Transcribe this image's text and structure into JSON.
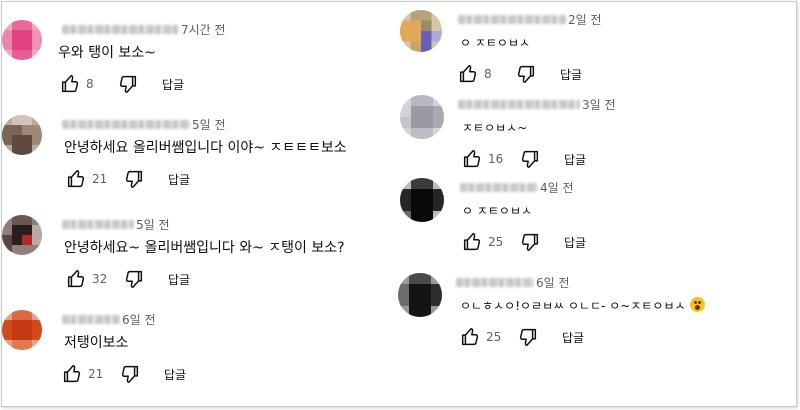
{
  "comments": [
    {
      "time": "7시간 전",
      "text": "우와 탱이 보소~",
      "likes": "8",
      "reply": "답글",
      "avatar": "pink-pixel-avatar"
    },
    {
      "time": "5일 전",
      "text": "안녕하세요 올리버쌤입니다 이야~ ㅈㅌㅌㅌ보소",
      "likes": "21",
      "reply": "답글",
      "avatar": "brown-pixel-avatar"
    },
    {
      "time": "5일 전",
      "text": "안녕하세요~ 올리버쌤입니다 와~ ㅈ탱이 보소?",
      "likes": "32",
      "reply": "답글",
      "avatar": "dark-pixel-avatar"
    },
    {
      "time": "6일 전",
      "text": "저탱이보소",
      "likes": "21",
      "reply": "답글",
      "avatar": "orange-pixel-avatar"
    },
    {
      "time": "2일 전",
      "text": "ㅇ ㅈㅌㅇㅂㅅ",
      "likes": "8",
      "reply": "답글",
      "avatar": "tan-purple-pixel-avatar"
    },
    {
      "time": "3일 전",
      "text": "ㅈㅌㅇㅂㅅ~",
      "likes": "16",
      "reply": "답글",
      "avatar": "gray-pixel-avatar"
    },
    {
      "time": "4일 전",
      "text": "ㅇ ㅈㅌㅇㅂㅅ",
      "likes": "25",
      "reply": "답글",
      "avatar": "black-pixel-avatar"
    },
    {
      "time": "6일 전",
      "text": "ㅇㄴㅎㅅㅇ!ㅇㄹㅂㅆ ㅇㄴㄷ- ㅇ~ㅈㅌㅇㅂㅅ",
      "likes": "25",
      "reply": "답글",
      "avatar": "black-gray-pixel-avatar",
      "emoji": "surprised-face-emoji"
    }
  ],
  "colors": {
    "text": "#0f0f0f",
    "meta": "#606060",
    "background": "#ffffff"
  }
}
